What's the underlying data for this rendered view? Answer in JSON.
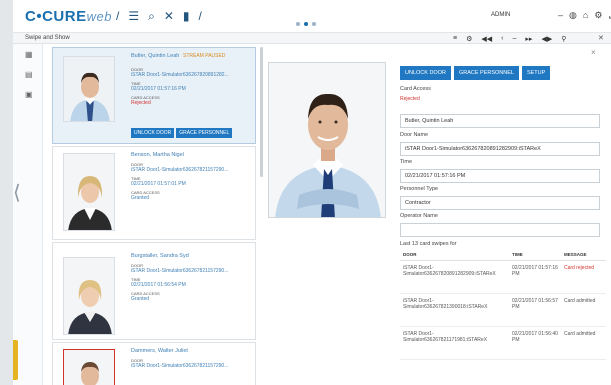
{
  "app": {
    "logo_main": "C•CURE",
    "logo_suffix": "web",
    "user": "ADMIN",
    "window_title": "Swipe and Show"
  },
  "cards": [
    {
      "name": "Butler, Quintin Leah",
      "badge": "STREAM PAUSED",
      "door_label": "DOOR",
      "door": "iSTAR Door1-Simulator636267820891282...",
      "time_label": "TIME",
      "time": "02/21/2017 01:57:16 PM",
      "access_label": "CARD ACCESS",
      "access": "Rejected",
      "buttons": [
        "UNLOCK DOOR",
        "GRACE PERSONNEL"
      ]
    },
    {
      "name": "Benson, Martha Nigel",
      "door_label": "DOOR",
      "door": "iSTAR Door1-Simulator636267821157290...",
      "time_label": "TIME",
      "time": "02/21/2017 01:57:01 PM",
      "access_label": "CARD ACCESS",
      "access": "Granted"
    },
    {
      "name": "Burgstaller, Sandra Syd",
      "door_label": "DOOR",
      "door": "iSTAR Door1-Simulator636267821157290...",
      "time_label": "TIME",
      "time": "02/21/2017 01:56:54 PM",
      "access_label": "CARD ACCESS",
      "access": "Granted"
    },
    {
      "name": "Dammers, Walter Juliet",
      "door_label": "DOOR",
      "door": "iSTAR Door1-Simulator636267821157290..."
    }
  ],
  "detail": {
    "actions": [
      "UNLOCK DOOR",
      "GRACE PERSONNEL",
      "SETUP"
    ],
    "card_access_label": "Card Access",
    "card_access_value": "Rejected",
    "name_value": "Butler, Quintin Leah",
    "door_name_label": "Door Name",
    "door_name_value": "iSTAR Door1-Simulator636267820891282909:iSTAReX",
    "time_label": "Time",
    "time_value": "02/21/2017 01:57:16 PM",
    "personnel_type_label": "Personnel Type",
    "personnel_type_value": "Contractor",
    "operator_name_label": "Operator Name",
    "operator_name_value": "",
    "swipes_title": "Last 13 card swipes for",
    "swipes_headers": [
      "DOOR",
      "TIME",
      "MESSAGE"
    ],
    "swipes": [
      {
        "door": "iSTAR Door1-Simulator636267820891282909:iSTAReX",
        "time": "02/21/2017 01:57:16 PM",
        "message": "Card rejected",
        "rejected": true
      },
      {
        "door": "iSTAR Door1-Simulator636267821390018:iSTAReX",
        "time": "02/21/2017 01:56:57 PM",
        "message": "Card admitted",
        "rejected": false
      },
      {
        "door": "iSTAR Door1-Simulator636267821171981:iSTAReX",
        "time": "02/21/2017 01:56:40 PM",
        "message": "Card admitted",
        "rejected": false
      }
    ]
  },
  "colors": {
    "brand": "#1a6fae",
    "button": "#1f78c1",
    "rejected": "#d2322d",
    "link": "#3f7fb4",
    "badge": "#d98b1f"
  }
}
